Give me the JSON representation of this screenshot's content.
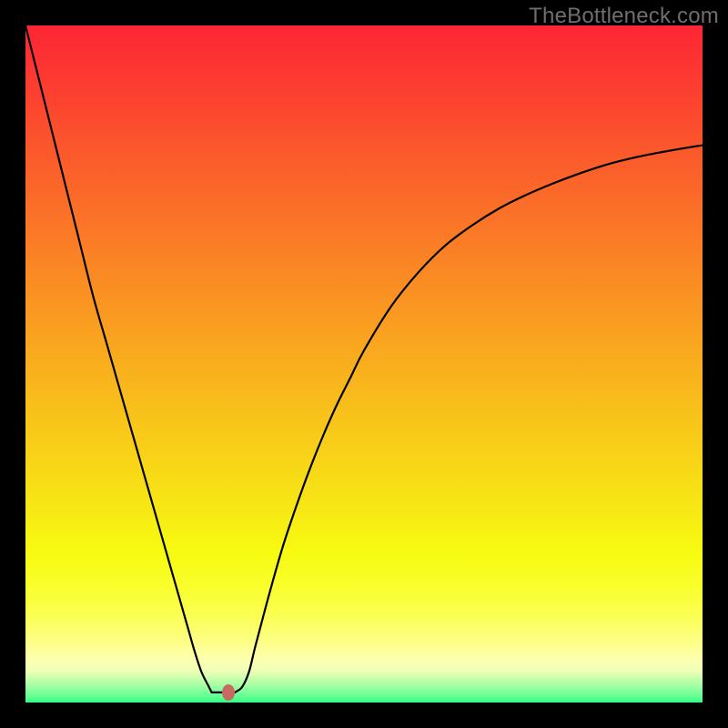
{
  "watermark": {
    "text": "TheBottleneck.com"
  },
  "colors": {
    "frame": "#000000",
    "curve_stroke": "#000000",
    "marker_fill": "#c76b62",
    "gradient_stops": [
      {
        "pos": 0.0,
        "hex": "#fd2534"
      },
      {
        "pos": 0.1,
        "hex": "#fc4030"
      },
      {
        "pos": 0.2,
        "hex": "#fb5c2b"
      },
      {
        "pos": 0.3,
        "hex": "#fb7727"
      },
      {
        "pos": 0.4,
        "hex": "#fa9222"
      },
      {
        "pos": 0.5,
        "hex": "#f9ae1e"
      },
      {
        "pos": 0.6,
        "hex": "#f8c919"
      },
      {
        "pos": 0.7,
        "hex": "#f7e415"
      },
      {
        "pos": 0.78,
        "hex": "#f7fb11"
      },
      {
        "pos": 0.83,
        "hex": "#f9ff2d"
      },
      {
        "pos": 0.87,
        "hex": "#faff51"
      },
      {
        "pos": 0.895,
        "hex": "#fcff71"
      },
      {
        "pos": 0.918,
        "hex": "#fdff92"
      },
      {
        "pos": 0.935,
        "hex": "#feffae"
      },
      {
        "pos": 0.953,
        "hex": "#efffb6"
      },
      {
        "pos": 0.962,
        "hex": "#d2ffaf"
      },
      {
        "pos": 0.97,
        "hex": "#b5ffa7"
      },
      {
        "pos": 0.978,
        "hex": "#99ffa0"
      },
      {
        "pos": 0.985,
        "hex": "#7cff99"
      },
      {
        "pos": 0.992,
        "hex": "#5fff91"
      },
      {
        "pos": 0.997,
        "hex": "#42ff8a"
      },
      {
        "pos": 1.0,
        "hex": "#29f983"
      }
    ]
  },
  "chart_data": {
    "type": "line",
    "title": "",
    "xlabel": "",
    "ylabel": "",
    "xlim": [
      0,
      100
    ],
    "ylim": [
      0,
      100
    ],
    "series": [
      {
        "name": "bottleneck-curve",
        "x": [
          0,
          2,
          4,
          6,
          8,
          10,
          12,
          14,
          16,
          18,
          20,
          22,
          24,
          25,
          26,
          27,
          28,
          29,
          30,
          31,
          32,
          33,
          34,
          36,
          38,
          40,
          42,
          44,
          46,
          48,
          50,
          54,
          58,
          62,
          66,
          70,
          74,
          78,
          82,
          86,
          90,
          94,
          98,
          100
        ],
        "y": [
          100,
          92,
          84,
          76,
          68,
          60,
          53,
          46,
          39,
          32,
          25,
          18,
          11,
          7.5,
          4.5,
          2.5,
          1.6,
          1.5,
          1.5,
          1.6,
          2.3,
          4.5,
          8.5,
          16,
          23,
          29,
          34.5,
          39.5,
          44,
          48,
          52,
          58.5,
          63.5,
          67.5,
          70.5,
          73,
          75,
          76.7,
          78.2,
          79.5,
          80.5,
          81.3,
          82,
          82.3
        ]
      }
    ],
    "marker": {
      "name": "current-point",
      "x": 30,
      "y": 1.5
    },
    "plateau": {
      "x_start": 27.5,
      "x_end": 31,
      "y": 1.5
    }
  }
}
